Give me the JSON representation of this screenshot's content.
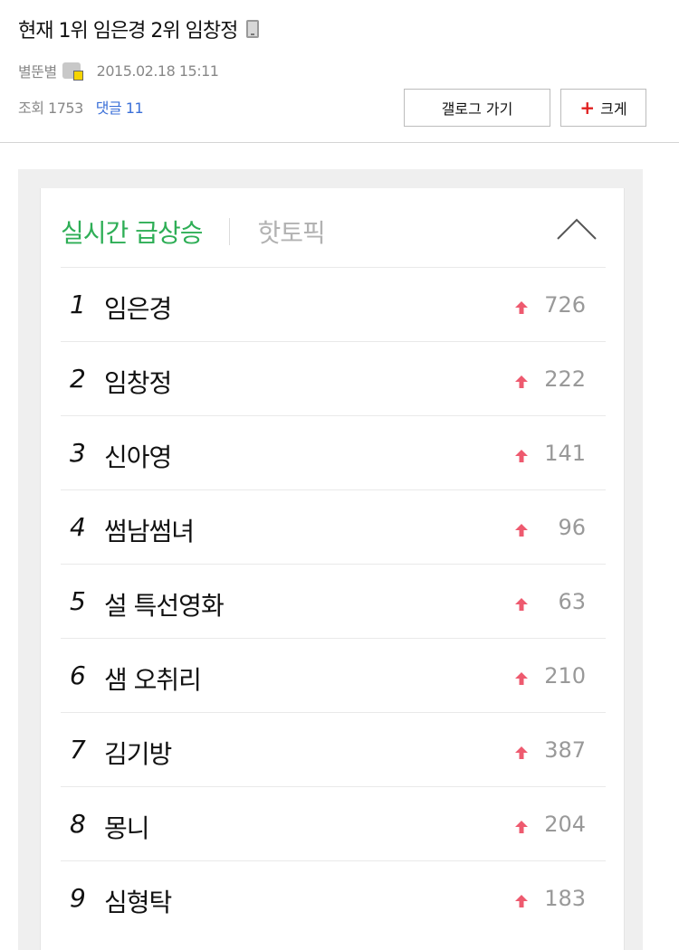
{
  "post": {
    "title": "현재 1위 임은경 2위 임창정",
    "author": "별뚠별",
    "datetime": "2015.02.18 15:11",
    "views": "조회 1753",
    "comments": "댓글 11",
    "gallery_button": "갤로그 가기",
    "zoom_button": "크게"
  },
  "ranking": {
    "active_tab": "실시간 급상승",
    "inactive_tab": "핫토픽",
    "items": [
      {
        "rank": "1",
        "keyword": "임은경",
        "count": "726"
      },
      {
        "rank": "2",
        "keyword": "임창정",
        "count": "222"
      },
      {
        "rank": "3",
        "keyword": "신아영",
        "count": "141"
      },
      {
        "rank": "4",
        "keyword": "썸남썸녀",
        "count": "96"
      },
      {
        "rank": "5",
        "keyword": "설 특선영화",
        "count": "63"
      },
      {
        "rank": "6",
        "keyword": "샘 오취리",
        "count": "210"
      },
      {
        "rank": "7",
        "keyword": "김기방",
        "count": "387"
      },
      {
        "rank": "8",
        "keyword": "몽니",
        "count": "204"
      },
      {
        "rank": "9",
        "keyword": "심형탁",
        "count": "183"
      }
    ]
  },
  "colors": {
    "accent_green": "#2eae56",
    "arrow_red": "#ee5a6f",
    "link_blue": "#3a6fd8"
  }
}
